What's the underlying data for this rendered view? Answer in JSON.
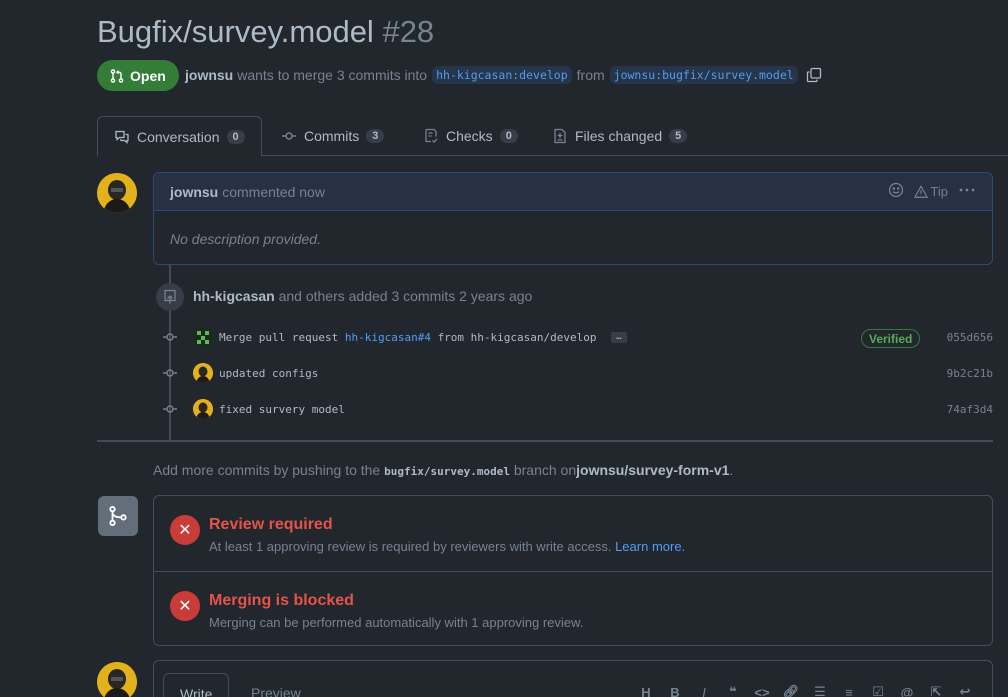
{
  "pr": {
    "title": "Bugfix/survey.model",
    "number": "#28",
    "state": "Open",
    "author": "jownsu",
    "merge_text": "wants to merge 3 commits into",
    "base_ref": "hh-kigcasan:develop",
    "from_text": "from",
    "head_ref": "jownsu:bugfix/survey.model"
  },
  "tabs": [
    {
      "label": "Conversation",
      "count": "0"
    },
    {
      "label": "Commits",
      "count": "3"
    },
    {
      "label": "Checks",
      "count": "0"
    },
    {
      "label": "Files changed",
      "count": "5"
    }
  ],
  "comment": {
    "author": "jownsu",
    "action": "commented now",
    "tip": "Tip",
    "body": "No description provided."
  },
  "timeline": {
    "actor": "hh-kigcasan",
    "text": "and others added 3 commits 2 years ago",
    "commits": [
      {
        "msg_pre": "Merge pull request",
        "link": "hh-kigcasan#4",
        "msg_post": "from hh-kigcasan/develop",
        "ellipsis": "…",
        "badge": "Verified",
        "sha": "055d656"
      },
      {
        "msg_pre": "updated configs",
        "sha": "9b2c21b"
      },
      {
        "msg_pre": "fixed survery model",
        "sha": "74af3d4"
      }
    ]
  },
  "hint": {
    "pre": "Add more commits by pushing to the",
    "branch": "bugfix/survey.model",
    "mid": "branch on",
    "repo": "jownsu/survey-form-v1",
    "post": "."
  },
  "merge": {
    "review": {
      "title": "Review required",
      "desc": "At least 1 approving review is required by reviewers with write access.",
      "link": "Learn more."
    },
    "blocked": {
      "title": "Merging is blocked",
      "desc": "Merging can be performed automatically with 1 approving review."
    }
  },
  "editor": {
    "write": "Write",
    "preview": "Preview",
    "tools": [
      "H",
      "B",
      "I"
    ]
  },
  "colors": {
    "open_green": "#347d39",
    "link_blue": "#539bf5",
    "error_red": "#e5534b"
  }
}
